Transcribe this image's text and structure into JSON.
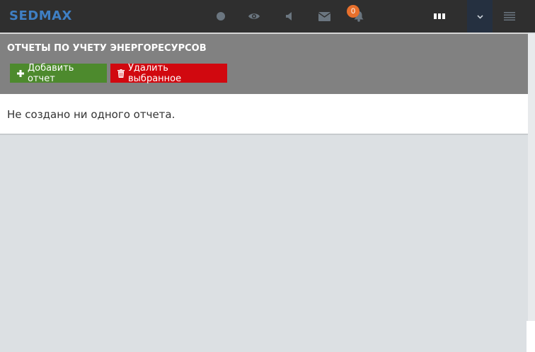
{
  "topbar": {
    "logo_text": "SEDMAX",
    "icons": [
      "circle-icon",
      "eye-icon",
      "speaker-icon",
      "envelope-icon",
      "bell-icon",
      "grid-icon",
      "chevron-down-icon",
      "menu-icon"
    ],
    "notifications_count": "0"
  },
  "header": {
    "title": "ОТЧЕТЫ ПО УЧЕТУ ЭНЕРГОРЕСУРСОВ",
    "add_button_label": "Добавить отчет",
    "delete_button_label": "Удалить выбранное"
  },
  "content": {
    "empty_message": "Не создано ни одного отчета."
  },
  "colors": {
    "topbar_bg": "#2f2f2f",
    "logo": "#3f7fc4",
    "header_bg": "#818181",
    "add_button": "#4d8a2d",
    "delete_button": "#d1080f",
    "badge": "#e8702c",
    "page_bg": "#dce0e3"
  }
}
